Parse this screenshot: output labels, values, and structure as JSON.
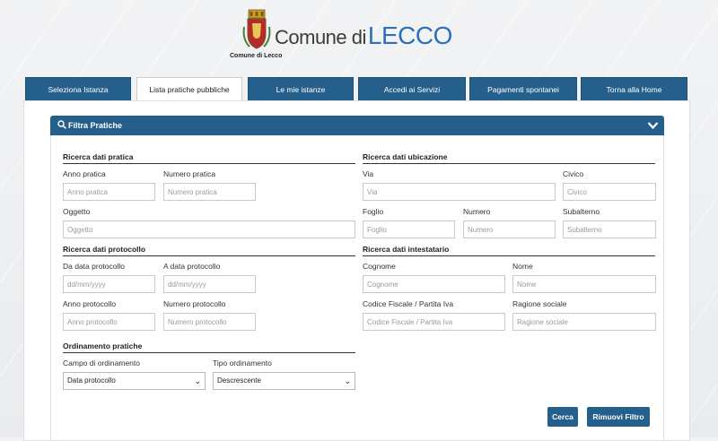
{
  "header": {
    "brand_prefix": "Comune di",
    "brand_city": "LECCO",
    "crest_caption": "Comune di Lecco"
  },
  "tabs": [
    {
      "label": "Seleziona Istanza",
      "active": false
    },
    {
      "label": "Lista pratiche pubbliche",
      "active": true
    },
    {
      "label": "Le mie istanze",
      "active": false
    },
    {
      "label": "Accedi ai Servizi",
      "active": false
    },
    {
      "label": "Pagamenti spontanei",
      "active": false
    },
    {
      "label": "Torna alla Home",
      "active": false
    }
  ],
  "filter": {
    "title": "Filtra Pratiche",
    "sections": {
      "pratica": "Ricerca dati pratica",
      "ubicazione": "Ricerca dati ubicazione",
      "protocollo": "Ricerca dati protocollo",
      "intestatario": "Ricerca dati intestatario",
      "ordinamento": "Ordinamento pratiche"
    },
    "fields": {
      "anno_pratica": {
        "label": "Anno pratica",
        "placeholder": "Anno pratica"
      },
      "numero_pratica": {
        "label": "Numero pratica",
        "placeholder": "Numero pratica"
      },
      "oggetto": {
        "label": "Oggetto",
        "placeholder": "Oggetto"
      },
      "via": {
        "label": "Via",
        "placeholder": "Via"
      },
      "civico": {
        "label": "Civico",
        "placeholder": "Civico"
      },
      "foglio": {
        "label": "Foglio",
        "placeholder": "Foglio"
      },
      "numero": {
        "label": "Numero",
        "placeholder": "Numero"
      },
      "subalterno": {
        "label": "Subalterno",
        "placeholder": "Subalterno"
      },
      "da_data": {
        "label": "Da data protocollo",
        "placeholder": "dd/mm/yyyy"
      },
      "a_data": {
        "label": "A data protocollo",
        "placeholder": "dd/mm/yyyy"
      },
      "anno_protocollo": {
        "label": "Anno protocollo",
        "placeholder": "Anno protocollo"
      },
      "numero_protocollo": {
        "label": "Numero protocollo",
        "placeholder": "Numero protocollo"
      },
      "cognome": {
        "label": "Cognome",
        "placeholder": "Cognome"
      },
      "nome": {
        "label": "Nome",
        "placeholder": "Nome"
      },
      "codice_fiscale": {
        "label": "Codice Fiscale / Partita Iva",
        "placeholder": "Codice Fiscale / Partita Iva"
      },
      "ragione_sociale": {
        "label": "Ragione sociale",
        "placeholder": "Ragione sociale"
      },
      "campo_ordinamento": {
        "label": "Campo di ordinamento",
        "value": "Data protocollo"
      },
      "tipo_ordinamento": {
        "label": "Tipo ordinamento",
        "value": "Descrescente"
      }
    },
    "buttons": {
      "search": "Cerca",
      "reset": "Rimuovi Filtro"
    }
  },
  "icons": {
    "search": "search-icon",
    "collapse": "chevron-down-icon",
    "select": "chevron-down-icon"
  },
  "colors": {
    "primary": "#255f8b",
    "brand_blue": "#2e6fb8"
  }
}
